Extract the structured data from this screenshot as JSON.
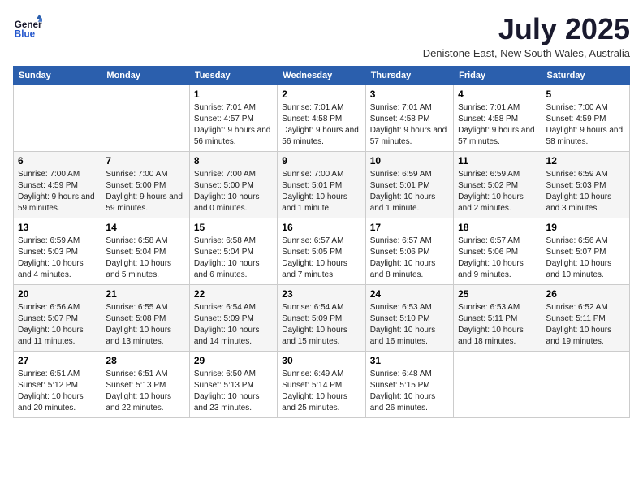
{
  "header": {
    "logo_line1": "General",
    "logo_line2": "Blue",
    "month_year": "July 2025",
    "location": "Denistone East, New South Wales, Australia"
  },
  "calendar": {
    "days_of_week": [
      "Sunday",
      "Monday",
      "Tuesday",
      "Wednesday",
      "Thursday",
      "Friday",
      "Saturday"
    ],
    "weeks": [
      [
        {
          "day": "",
          "text": ""
        },
        {
          "day": "",
          "text": ""
        },
        {
          "day": "1",
          "text": "Sunrise: 7:01 AM\nSunset: 4:57 PM\nDaylight: 9 hours and 56 minutes."
        },
        {
          "day": "2",
          "text": "Sunrise: 7:01 AM\nSunset: 4:58 PM\nDaylight: 9 hours and 56 minutes."
        },
        {
          "day": "3",
          "text": "Sunrise: 7:01 AM\nSunset: 4:58 PM\nDaylight: 9 hours and 57 minutes."
        },
        {
          "day": "4",
          "text": "Sunrise: 7:01 AM\nSunset: 4:58 PM\nDaylight: 9 hours and 57 minutes."
        },
        {
          "day": "5",
          "text": "Sunrise: 7:00 AM\nSunset: 4:59 PM\nDaylight: 9 hours and 58 minutes."
        }
      ],
      [
        {
          "day": "6",
          "text": "Sunrise: 7:00 AM\nSunset: 4:59 PM\nDaylight: 9 hours and 59 minutes."
        },
        {
          "day": "7",
          "text": "Sunrise: 7:00 AM\nSunset: 5:00 PM\nDaylight: 9 hours and 59 minutes."
        },
        {
          "day": "8",
          "text": "Sunrise: 7:00 AM\nSunset: 5:00 PM\nDaylight: 10 hours and 0 minutes."
        },
        {
          "day": "9",
          "text": "Sunrise: 7:00 AM\nSunset: 5:01 PM\nDaylight: 10 hours and 1 minute."
        },
        {
          "day": "10",
          "text": "Sunrise: 6:59 AM\nSunset: 5:01 PM\nDaylight: 10 hours and 1 minute."
        },
        {
          "day": "11",
          "text": "Sunrise: 6:59 AM\nSunset: 5:02 PM\nDaylight: 10 hours and 2 minutes."
        },
        {
          "day": "12",
          "text": "Sunrise: 6:59 AM\nSunset: 5:03 PM\nDaylight: 10 hours and 3 minutes."
        }
      ],
      [
        {
          "day": "13",
          "text": "Sunrise: 6:59 AM\nSunset: 5:03 PM\nDaylight: 10 hours and 4 minutes."
        },
        {
          "day": "14",
          "text": "Sunrise: 6:58 AM\nSunset: 5:04 PM\nDaylight: 10 hours and 5 minutes."
        },
        {
          "day": "15",
          "text": "Sunrise: 6:58 AM\nSunset: 5:04 PM\nDaylight: 10 hours and 6 minutes."
        },
        {
          "day": "16",
          "text": "Sunrise: 6:57 AM\nSunset: 5:05 PM\nDaylight: 10 hours and 7 minutes."
        },
        {
          "day": "17",
          "text": "Sunrise: 6:57 AM\nSunset: 5:06 PM\nDaylight: 10 hours and 8 minutes."
        },
        {
          "day": "18",
          "text": "Sunrise: 6:57 AM\nSunset: 5:06 PM\nDaylight: 10 hours and 9 minutes."
        },
        {
          "day": "19",
          "text": "Sunrise: 6:56 AM\nSunset: 5:07 PM\nDaylight: 10 hours and 10 minutes."
        }
      ],
      [
        {
          "day": "20",
          "text": "Sunrise: 6:56 AM\nSunset: 5:07 PM\nDaylight: 10 hours and 11 minutes."
        },
        {
          "day": "21",
          "text": "Sunrise: 6:55 AM\nSunset: 5:08 PM\nDaylight: 10 hours and 13 minutes."
        },
        {
          "day": "22",
          "text": "Sunrise: 6:54 AM\nSunset: 5:09 PM\nDaylight: 10 hours and 14 minutes."
        },
        {
          "day": "23",
          "text": "Sunrise: 6:54 AM\nSunset: 5:09 PM\nDaylight: 10 hours and 15 minutes."
        },
        {
          "day": "24",
          "text": "Sunrise: 6:53 AM\nSunset: 5:10 PM\nDaylight: 10 hours and 16 minutes."
        },
        {
          "day": "25",
          "text": "Sunrise: 6:53 AM\nSunset: 5:11 PM\nDaylight: 10 hours and 18 minutes."
        },
        {
          "day": "26",
          "text": "Sunrise: 6:52 AM\nSunset: 5:11 PM\nDaylight: 10 hours and 19 minutes."
        }
      ],
      [
        {
          "day": "27",
          "text": "Sunrise: 6:51 AM\nSunset: 5:12 PM\nDaylight: 10 hours and 20 minutes."
        },
        {
          "day": "28",
          "text": "Sunrise: 6:51 AM\nSunset: 5:13 PM\nDaylight: 10 hours and 22 minutes."
        },
        {
          "day": "29",
          "text": "Sunrise: 6:50 AM\nSunset: 5:13 PM\nDaylight: 10 hours and 23 minutes."
        },
        {
          "day": "30",
          "text": "Sunrise: 6:49 AM\nSunset: 5:14 PM\nDaylight: 10 hours and 25 minutes."
        },
        {
          "day": "31",
          "text": "Sunrise: 6:48 AM\nSunset: 5:15 PM\nDaylight: 10 hours and 26 minutes."
        },
        {
          "day": "",
          "text": ""
        },
        {
          "day": "",
          "text": ""
        }
      ]
    ]
  }
}
